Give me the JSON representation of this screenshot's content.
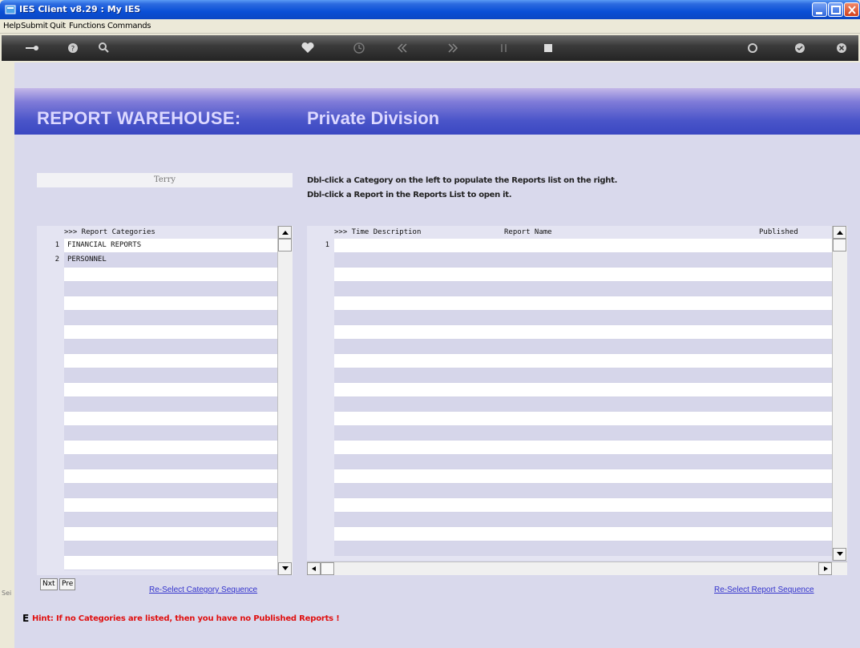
{
  "window": {
    "title": "IES Client v8.29 : My IES"
  },
  "menu": {
    "items": [
      "Help",
      "Submit",
      "Quit",
      "Functions",
      "Commands"
    ]
  },
  "toolbar": {
    "icons": [
      "key-icon",
      "help-icon",
      "search-icon",
      "heart-icon",
      "clock-icon",
      "rewind-icon",
      "forward-icon",
      "tools-icon",
      "stop-icon",
      "refresh-icon",
      "check-icon",
      "close-icon"
    ]
  },
  "header": {
    "left": "REPORT WAREHOUSE:",
    "right": "Private Division"
  },
  "user": {
    "name": "Terry"
  },
  "instructions": {
    "line1": "Dbl-click a Category on the left to populate the Reports list on the right.",
    "line2": "Dbl-click a Report in the Reports  List  to open it."
  },
  "categories": {
    "header": ">>> Report Categories",
    "rows": [
      {
        "num": "1",
        "label": "FINANCIAL REPORTS"
      },
      {
        "num": "2",
        "label": "PERSONNEL"
      }
    ]
  },
  "reports": {
    "header_col1": ">>> Time Description",
    "header_col2": "Report Name",
    "header_col3": "Published",
    "rows": [
      {
        "num": "1"
      }
    ]
  },
  "buttons": {
    "nxt": "Nxt",
    "pre": "Pre"
  },
  "links": {
    "reselect_category": "Re-Select Category Sequence",
    "reselect_report": "Re-Select Report Sequence"
  },
  "hint": {
    "mark": "E",
    "text": "Hint: If no Categories are listed, then you have no Published Reports !"
  },
  "side_label": "Sei",
  "colors": {
    "accent": "#3a47c2",
    "hint": "#e01010",
    "link": "#3333cc"
  }
}
